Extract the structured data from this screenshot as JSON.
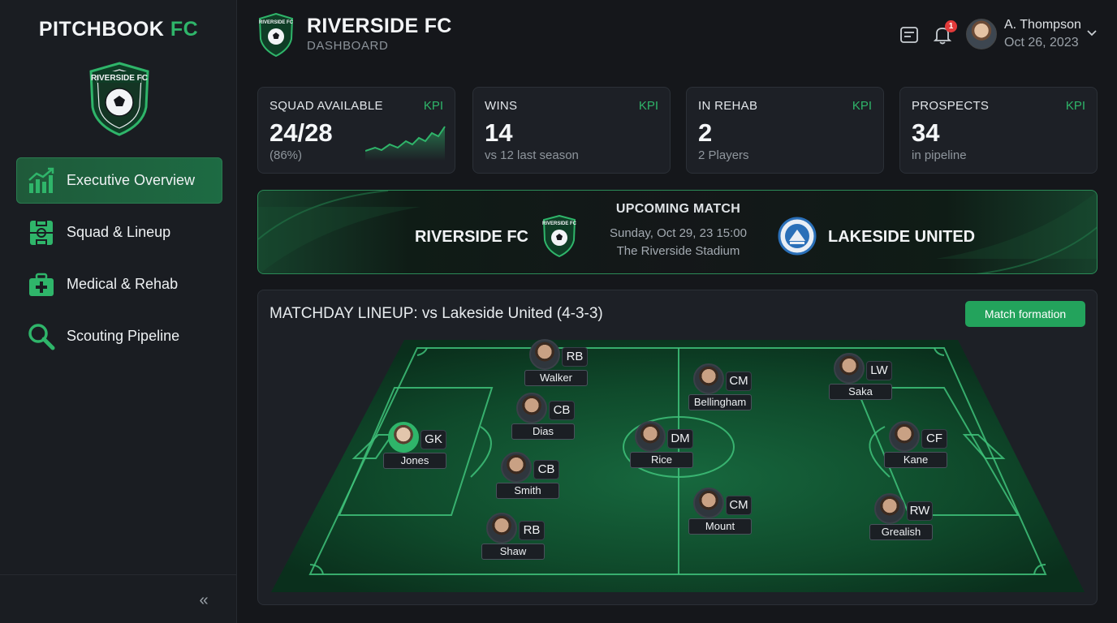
{
  "brand": {
    "name_main": "PITCHBOOK",
    "name_accent": "FC"
  },
  "sidebar": {
    "items": [
      {
        "label": "Executive Overview",
        "icon": "chart-icon",
        "active": true
      },
      {
        "label": "Squad & Lineup",
        "icon": "lineup-icon",
        "active": false
      },
      {
        "label": "Medical & Rehab",
        "icon": "medical-kit-icon",
        "active": false
      },
      {
        "label": "Scouting Pipeline",
        "icon": "search-icon",
        "active": false
      }
    ]
  },
  "header": {
    "title": "RIVERSIDE FC",
    "subtitle": "DASHBOARD",
    "notification_count": "1",
    "user_name": "A. Thompson",
    "date": "Oct 26, 2023"
  },
  "kpis": [
    {
      "label": "SQUAD AVAILABLE",
      "tag": "KPI",
      "value": "24/28",
      "sub": "(86%)"
    },
    {
      "label": "WINS",
      "tag": "KPI",
      "value": "14",
      "sub": "vs 12 last season"
    },
    {
      "label": "IN REHAB",
      "tag": "KPI",
      "value": "2",
      "sub": "2 Players"
    },
    {
      "label": "PROSPECTS",
      "tag": "KPI",
      "value": "34",
      "sub": "in pipeline"
    }
  ],
  "match": {
    "heading": "UPCOMING MATCH",
    "home": "RIVERSIDE FC",
    "away": "LAKESIDE UNITED",
    "datetime": "Sunday, Oct 29, 23 15:00",
    "venue": "The Riverside Stadium"
  },
  "lineup": {
    "title": "MATCHDAY LINEUP: vs Lakeside United (4-3-3)",
    "button": "Match formation",
    "players": [
      {
        "pos": "GK",
        "name": "Jones"
      },
      {
        "pos": "RB",
        "name": "Walker"
      },
      {
        "pos": "CB",
        "name": "Dias"
      },
      {
        "pos": "CB",
        "name": "Smith"
      },
      {
        "pos": "RB",
        "name": "Shaw"
      },
      {
        "pos": "CM",
        "name": "Bellingham"
      },
      {
        "pos": "DM",
        "name": "Rice"
      },
      {
        "pos": "CM",
        "name": "Mount"
      },
      {
        "pos": "LW",
        "name": "Saka"
      },
      {
        "pos": "CF",
        "name": "Kane"
      },
      {
        "pos": "RW",
        "name": "Grealish"
      }
    ]
  },
  "colors": {
    "accent": "#2fb56a",
    "background": "#15171b",
    "card": "#1d2026",
    "pitch": "#0f4a2a",
    "alert": "#e23a3a"
  }
}
